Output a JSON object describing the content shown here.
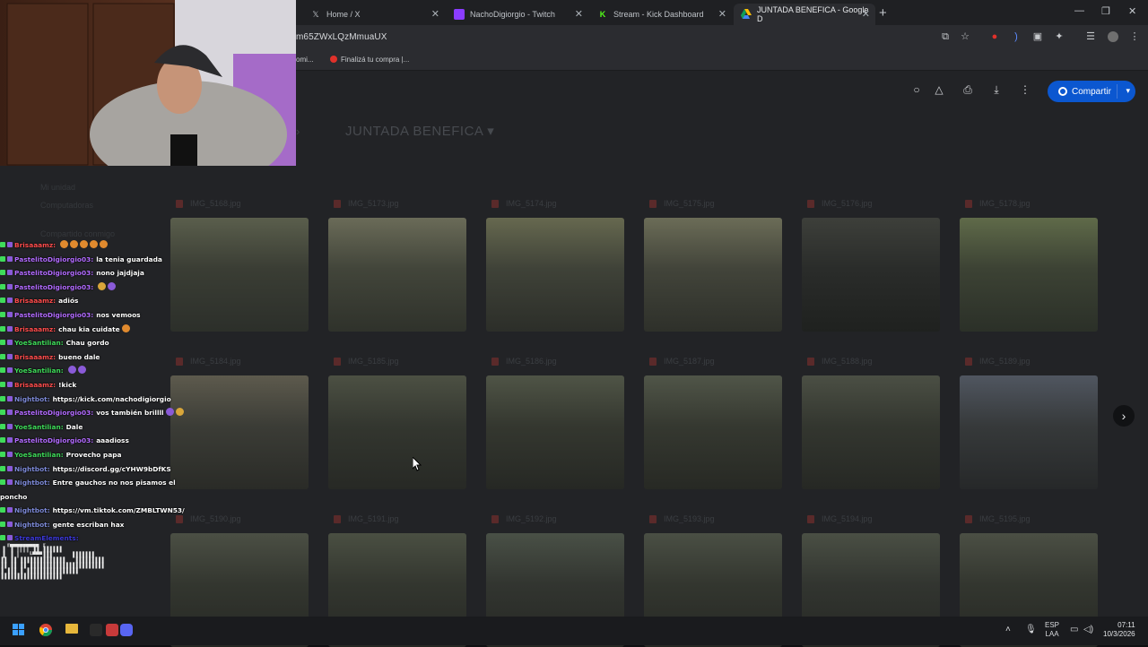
{
  "browser": {
    "tabs": [
      {
        "label": "Home / X",
        "icon": "x-logo-icon",
        "left": 0
      },
      {
        "label": "NachoDigiorgio - Twitch",
        "icon": "twitch-icon"
      },
      {
        "label": "Stream - Kick Dashboard",
        "icon": "kick-icon"
      },
      {
        "label": "JUNTADA BENEFICA - Google D",
        "icon": "drive-icon",
        "active": true
      }
    ],
    "new_tab": "+",
    "minimize": "—",
    "maximize": "❐",
    "close": "✕",
    "url": "m65ZWxLQzMmuaUX",
    "bookmarks": [
      {
        "label": "omi..."
      },
      {
        "label": "Finalizá tu compra |..."
      }
    ]
  },
  "drive": {
    "folder_title": "JUNTADA BENEFICA",
    "share_label": "Compartir",
    "files": [
      {
        "name": "IMG_5168.jpg"
      },
      {
        "name": "IMG_5173.jpg"
      },
      {
        "name": "IMG_5174.jpg"
      },
      {
        "name": "IMG_5175.jpg"
      },
      {
        "name": "IMG_5176.jpg"
      },
      {
        "name": "IMG_5178.jpg"
      },
      {
        "name": "IMG_5184.jpg"
      },
      {
        "name": "IMG_5185.jpg"
      },
      {
        "name": "IMG_5186.jpg"
      },
      {
        "name": "IMG_5187.jpg"
      },
      {
        "name": "IMG_5188.jpg"
      },
      {
        "name": "IMG_5189.jpg"
      },
      {
        "name": "IMG_5190.jpg"
      },
      {
        "name": "IMG_5191.jpg"
      },
      {
        "name": "IMG_5192.jpg"
      },
      {
        "name": "IMG_5193.jpg"
      },
      {
        "name": "IMG_5194.jpg"
      },
      {
        "name": "IMG_5195.jpg"
      }
    ],
    "sidebar_ghost": [
      "Mi unidad",
      "Computadoras",
      "Compartido conmigo"
    ]
  },
  "chat": {
    "messages": [
      {
        "user": "Brisaaamz:",
        "text": "",
        "ucolor": "#ff4d4d",
        "emotes": [
          "#e08a2e",
          "#e08a2e",
          "#e08a2e",
          "#e08a2e",
          "#e08a2e"
        ]
      },
      {
        "user": "PastelitoDigiorgio03:",
        "text": "la tenia guardada",
        "ucolor": "#b26bff"
      },
      {
        "user": "PastelitoDigiorgio03:",
        "text": "nono jajdjaja",
        "ucolor": "#b26bff"
      },
      {
        "user": "PastelitoDigiorgio03:",
        "text": "",
        "ucolor": "#b26bff",
        "emotes": [
          "#d9a63a",
          "#8a5ad8"
        ]
      },
      {
        "user": "Brisaaamz:",
        "text": "adiós",
        "ucolor": "#ff4d4d"
      },
      {
        "user": "PastelitoDigiorgio03:",
        "text": "nos vemoos",
        "ucolor": "#b26bff"
      },
      {
        "user": "Brisaaamz:",
        "text": "chau kia cuidate",
        "ucolor": "#ff4d4d",
        "emotes": [
          "#e08a2e"
        ]
      },
      {
        "user": "YoeSantilian:",
        "text": "Chau gordo",
        "ucolor": "#3fdc5a"
      },
      {
        "user": "Brisaaamz:",
        "text": "bueno dale",
        "ucolor": "#ff4d4d"
      },
      {
        "user": "YoeSantilian:",
        "text": "",
        "ucolor": "#3fdc5a",
        "emotes": [
          "#8a5ad8",
          "#8a5ad8"
        ]
      },
      {
        "user": "Brisaaamz:",
        "text": "!kick",
        "ucolor": "#ff4d4d"
      },
      {
        "user": "Nightbot:",
        "text": "https://kick.com/nachodigiorgio",
        "ucolor": "#7d8ad8"
      },
      {
        "user": "PastelitoDigiorgio03:",
        "text": "vos también brillll",
        "ucolor": "#b26bff",
        "emotes": [
          "#8a5ad8",
          "#d9a63a"
        ]
      },
      {
        "user": "YoeSantilian:",
        "text": "Dale",
        "ucolor": "#3fdc5a"
      },
      {
        "user": "PastelitoDigiorgio03:",
        "text": "aaadioss",
        "ucolor": "#b26bff"
      },
      {
        "user": "YoeSantilian:",
        "text": "Provecho papa",
        "ucolor": "#3fdc5a"
      },
      {
        "user": "Nightbot:",
        "text": "https://discord.gg/cYHW9bDfKS",
        "ucolor": "#7d8ad8"
      },
      {
        "user": "Nightbot:",
        "text": "Entre gauchos no nos pisamos el",
        "ucolor": "#7d8ad8",
        "cont": "poncho"
      },
      {
        "user": "Nightbot:",
        "text": "https://vm.tiktok.com/ZMBLTWN53/",
        "ucolor": "#7d8ad8"
      },
      {
        "user": "Nightbot:",
        "text": "gente escriban hax",
        "ucolor": "#7d8ad8"
      },
      {
        "user": "StreamElements:",
        "text": "",
        "ucolor": "#3c39d8"
      }
    ]
  },
  "taskbar": {
    "lang": "ESP",
    "lang_sub": "LAA",
    "time": "07:11",
    "date": "10/3/2026"
  }
}
